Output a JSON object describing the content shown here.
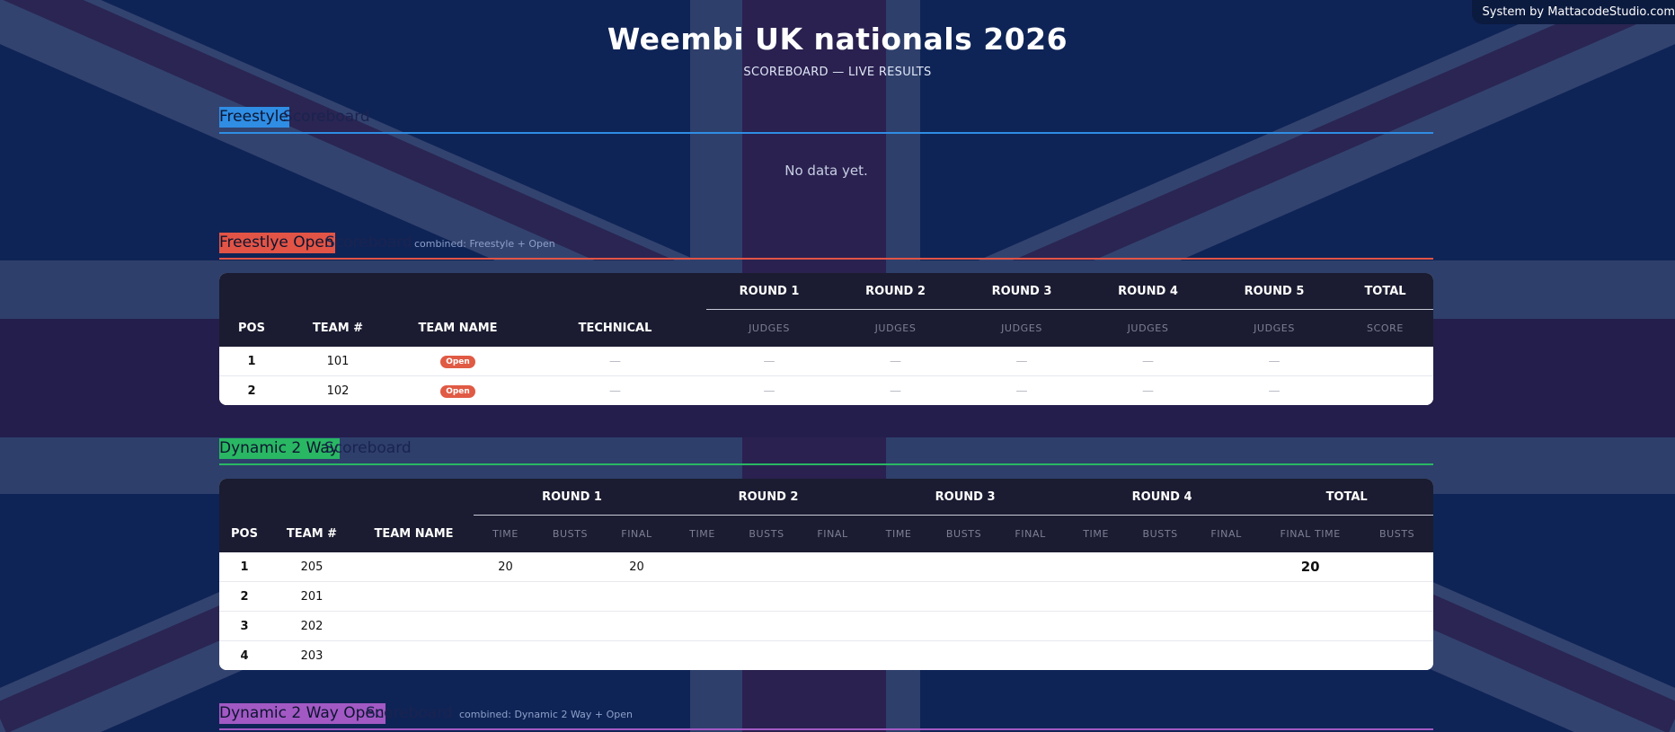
{
  "credit": "System by MattacodeStudio.com",
  "header": {
    "title": "Weembi UK nationals 2026",
    "subtitle": "SCOREBOARD — LIVE RESULTS"
  },
  "colors": {
    "background": "#0f2456",
    "freestyle_accent": "#2f8de4",
    "freestyle_open_accent": "#e25446",
    "dynamic_accent": "#29b763",
    "dynamic_open_accent": "#a259c4",
    "table_header": "#1b1c31",
    "badge": "#e05a44"
  },
  "freestyle": {
    "highlight": "Freestyle",
    "rest": "Scoreboard",
    "empty_text": "No data yet."
  },
  "freestyle_open": {
    "highlight": "Freestlye Open",
    "rest": "Scoreboard",
    "combined": "combined: Freestyle + Open",
    "headers": {
      "pos": "POS",
      "team_no": "TEAM #",
      "team_name": "TEAM NAME",
      "technical": "TECHNICAL",
      "rounds": [
        "ROUND 1",
        "ROUND 2",
        "ROUND 3",
        "ROUND 4",
        "ROUND 5"
      ],
      "round_sub": "JUDGES",
      "total": "TOTAL",
      "total_sub": "SCORE"
    },
    "rows": [
      {
        "pos": "1",
        "team_no": "101",
        "badge": "Open",
        "technical": "—",
        "rounds": [
          "—",
          "—",
          "—",
          "—",
          "—"
        ],
        "total": ""
      },
      {
        "pos": "2",
        "team_no": "102",
        "badge": "Open",
        "technical": "—",
        "rounds": [
          "—",
          "—",
          "—",
          "—",
          "—"
        ],
        "total": ""
      }
    ]
  },
  "dynamic": {
    "highlight": "Dynamic 2 Way",
    "rest": "Scoreboard",
    "headers": {
      "pos": "POS",
      "team_no": "TEAM #",
      "team_name": "TEAM NAME",
      "rounds": [
        "ROUND 1",
        "ROUND 2",
        "ROUND 3",
        "ROUND 4"
      ],
      "round_subs": [
        "TIME",
        "BUSTS",
        "FINAL"
      ],
      "total": "TOTAL",
      "total_subs": [
        "FINAL TIME",
        "BUSTS"
      ]
    },
    "rows": [
      {
        "pos": "1",
        "team_no": "205",
        "r1_time": "20",
        "r1_final": "20",
        "final_time": "20"
      },
      {
        "pos": "2",
        "team_no": "201",
        "r1_time": "",
        "r1_final": "",
        "final_time": ""
      },
      {
        "pos": "3",
        "team_no": "202",
        "r1_time": "",
        "r1_final": "",
        "final_time": ""
      },
      {
        "pos": "4",
        "team_no": "203",
        "r1_time": "",
        "r1_final": "",
        "final_time": ""
      }
    ]
  },
  "dynamic_open": {
    "highlight": "Dynamic 2 Way Open",
    "rest": "Scoreboard",
    "combined": "combined: Dynamic 2 Way + Open"
  }
}
